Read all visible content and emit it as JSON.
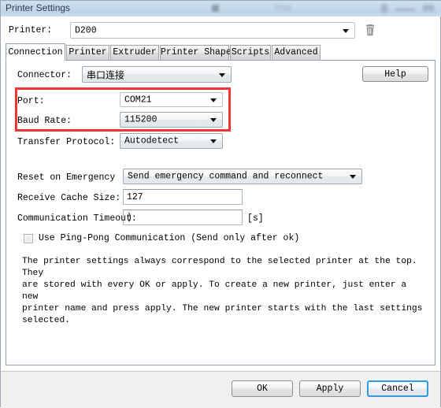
{
  "window": {
    "title": "Printer Settings",
    "colors": {
      "highlight_red": "#f03535",
      "focus_blue": "#3399dd",
      "titlebar": "#c6daea"
    }
  },
  "printer_row": {
    "label": "Printer:",
    "value": "D200",
    "delete_icon": "trash-icon"
  },
  "tabs": [
    {
      "label": "Connection",
      "active": true
    },
    {
      "label": "Printer",
      "active": false
    },
    {
      "label": "Extruder",
      "active": false
    },
    {
      "label": "Printer Shape",
      "active": false
    },
    {
      "label": "Scripts",
      "active": false
    },
    {
      "label": "Advanced",
      "active": false
    }
  ],
  "connection": {
    "connector": {
      "label": "Connector:",
      "value": "串口连接"
    },
    "help_button": "Help",
    "port": {
      "label": "Port:",
      "value": "COM21"
    },
    "baud_rate": {
      "label": "Baud Rate:",
      "value": "115200"
    },
    "transfer_protocol": {
      "label": "Transfer Protocol:",
      "value": "Autodetect"
    },
    "reset_on_emergency": {
      "label": "Reset on Emergency",
      "value": "Send emergency command and reconnect"
    },
    "receive_cache_size": {
      "label": "Receive Cache Size:",
      "value": "127"
    },
    "communication_timeout": {
      "label": "Communication Timeout:",
      "value": ")",
      "unit": "[s]"
    },
    "ping_pong": {
      "label": "Use Ping-Pong Communication (Send only after ok)",
      "checked": false
    },
    "info_text": "The printer settings always correspond to the selected printer at the top. They\nare stored with every OK or apply. To create a new printer, just enter a new\nprinter name and press apply. The new printer starts with the last settings\nselected."
  },
  "footer": {
    "ok": "OK",
    "apply": "Apply",
    "cancel": "Cancel"
  }
}
